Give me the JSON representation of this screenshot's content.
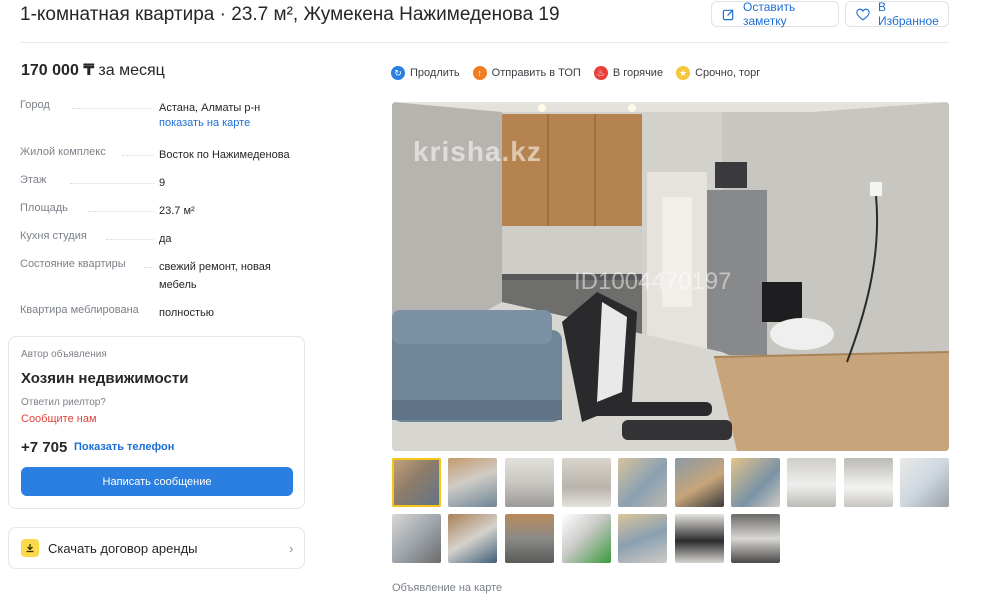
{
  "header": {
    "title": "1-комнатная квартира · 23.7 м², Жумекена Нажимеденова 19",
    "note_button": "Оставить заметку",
    "favorite_button": "В Избранное"
  },
  "price": {
    "amount": "170 000 ₸",
    "period": "за месяц"
  },
  "params": [
    {
      "key": "Город",
      "value": "Астана, Алматы р-н",
      "link": "показать на карте"
    },
    {
      "key": "Жилой комплекс",
      "value": "Восток по Нажимеденова"
    },
    {
      "key": "Этаж",
      "value": "9"
    },
    {
      "key": "Площадь",
      "value": "23.7 м²"
    },
    {
      "key": "Кухня студия",
      "value": "да"
    },
    {
      "key": "Состояние квартиры",
      "value": "свежий ремонт, новая мебель"
    },
    {
      "key": "Квартира меблирована",
      "value": "полностью"
    }
  ],
  "author": {
    "label": "Автор объявления",
    "name": "Хозяин недвижимости",
    "realtor_question": "Ответил риелтор?",
    "tell_us": "Сообщите нам",
    "phone": "+7 705",
    "show_phone": "Показать телефон",
    "message_button": "Написать сообщение"
  },
  "contract": {
    "label": "Скачать договор аренды"
  },
  "actions": [
    {
      "label": "Продлить",
      "icon": "renew-icon",
      "color": "#2b7fe0"
    },
    {
      "label": "Отправить в ТОП",
      "icon": "top-icon",
      "color": "#f07d22"
    },
    {
      "label": "В горячие",
      "icon": "fire-icon",
      "color": "#e7413a"
    },
    {
      "label": "Срочно, торг",
      "icon": "urgent-icon",
      "color": "#f7c63a"
    }
  ],
  "photo": {
    "watermark_site": "krisha.kz",
    "watermark_id": "ID1004470197"
  },
  "map_label": "Объявление на карте",
  "colors": {
    "link": "#1d6fd6",
    "accent_button": "#2b7fe0",
    "alert": "#e2423a",
    "active_thumb": "#f5c518"
  }
}
